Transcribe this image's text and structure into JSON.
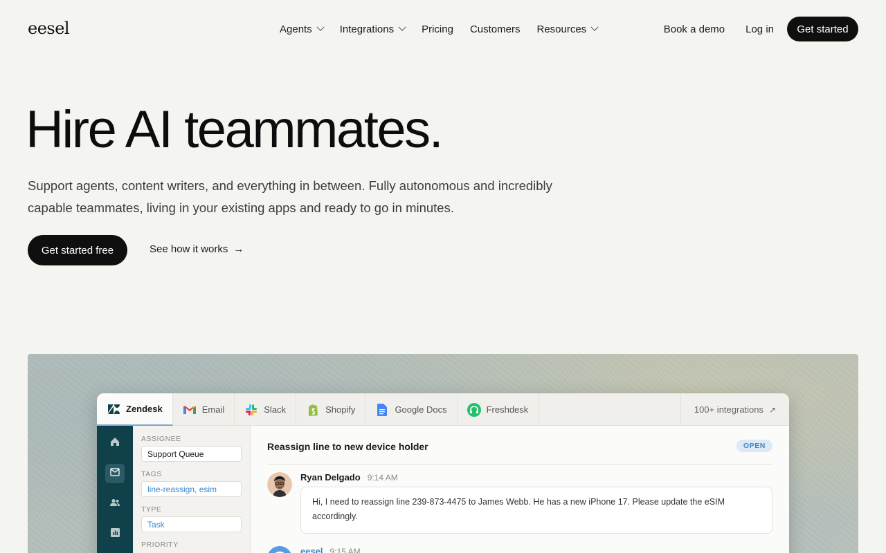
{
  "brand": {
    "logo": "eesel"
  },
  "nav": {
    "links": [
      {
        "label": "Agents",
        "dropdown": true
      },
      {
        "label": "Integrations",
        "dropdown": true
      },
      {
        "label": "Pricing",
        "dropdown": false
      },
      {
        "label": "Customers",
        "dropdown": false
      },
      {
        "label": "Resources",
        "dropdown": true
      }
    ],
    "book_demo": "Book a demo",
    "login": "Log in",
    "get_started": "Get started"
  },
  "hero": {
    "title": "Hire AI teammates.",
    "subtitle": "Support agents, content writers, and everything in between. Fully autonomous and incredibly capable teammates, living in your existing apps and ready to go in minutes.",
    "cta_primary": "Get started free",
    "cta_secondary": "See how it works",
    "cta_secondary_icon": "arrow-right-icon"
  },
  "app": {
    "tabs": [
      {
        "label": "Zendesk",
        "icon": "zendesk-icon",
        "active": true
      },
      {
        "label": "Email",
        "icon": "gmail-icon",
        "active": false
      },
      {
        "label": "Slack",
        "icon": "slack-icon",
        "active": false
      },
      {
        "label": "Shopify",
        "icon": "shopify-icon",
        "active": false
      },
      {
        "label": "Google Docs",
        "icon": "google-docs-icon",
        "active": false
      },
      {
        "label": "Freshdesk",
        "icon": "freshdesk-icon",
        "active": false
      }
    ],
    "more_integrations": "100+ integrations",
    "rail": [
      "home-icon",
      "mail-icon",
      "users-icon",
      "chart-icon"
    ],
    "properties": {
      "assignee_label": "ASSIGNEE",
      "assignee_value": "Support Queue",
      "tags_label": "TAGS",
      "tags_value": "line-reassign, esim",
      "type_label": "TYPE",
      "type_value": "Task",
      "priority_label": "PRIORITY"
    },
    "ticket": {
      "title": "Reassign line to new device holder",
      "status": "OPEN",
      "messages": [
        {
          "author": "Ryan Delgado",
          "time": "9:14 AM",
          "text": "Hi, I need to reassign line 239-873-4475 to James Webb. He has a new iPhone 17. Please update the eSIM accordingly."
        },
        {
          "author": "eesel",
          "time": "9:15 AM"
        }
      ]
    }
  },
  "colors": {
    "background": "#f4f4f0",
    "primary_button": "#0f0f0f",
    "rail": "#10414a",
    "accent_blue": "#3d87c9"
  }
}
